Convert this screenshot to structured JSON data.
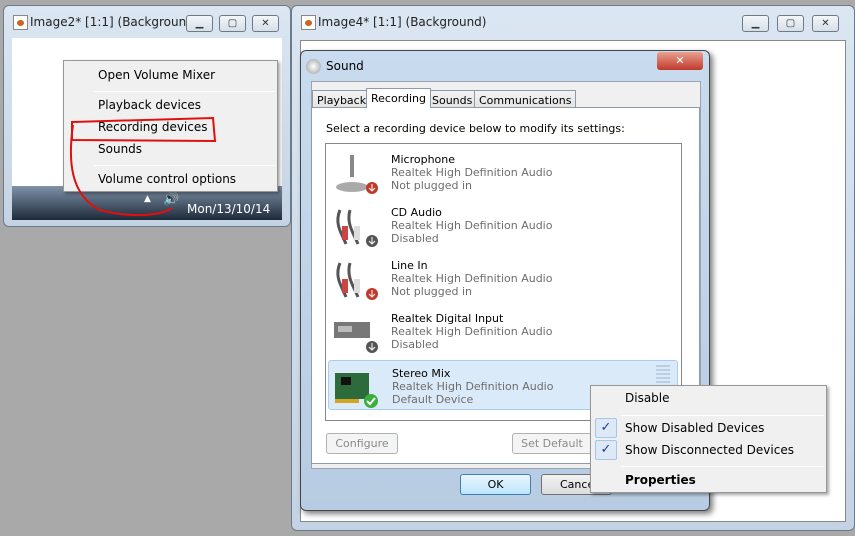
{
  "window1": {
    "title": "Image2* [1:1] (Background)",
    "clock": "Mon/13/10/14",
    "menu": [
      "Open Volume Mixer",
      "Playback devices",
      "Recording devices",
      "Sounds",
      "Volume control options"
    ]
  },
  "window2": {
    "title": "Image4* [1:1] (Background)"
  },
  "dialog": {
    "title": "Sound",
    "tabs": [
      "Playback",
      "Recording",
      "Sounds",
      "Communications"
    ],
    "active_tab": "Recording",
    "instruction": "Select a recording device below to modify its settings:",
    "devices": [
      {
        "name": "Microphone",
        "driver": "Realtek High Definition Audio",
        "status": "Not plugged in",
        "icon": "microphone-icon"
      },
      {
        "name": "CD Audio",
        "driver": "Realtek High Definition Audio",
        "status": "Disabled",
        "icon": "cd-audio-icon"
      },
      {
        "name": "Line In",
        "driver": "Realtek High Definition Audio",
        "status": "Not plugged in",
        "icon": "line-in-icon"
      },
      {
        "name": "Realtek Digital Input",
        "driver": "Realtek High Definition Audio",
        "status": "Disabled",
        "icon": "digital-input-icon"
      },
      {
        "name": "Stereo Mix",
        "driver": "Realtek High Definition Audio",
        "status": "Default Device",
        "icon": "sound-card-icon",
        "selected": true
      }
    ],
    "configure": "Configure",
    "set_default": "Set Default",
    "ok": "OK",
    "cancel": "Cancel"
  },
  "context_menu": {
    "items": [
      {
        "label": "Disable"
      },
      {
        "label": "Show Disabled Devices",
        "checked": true
      },
      {
        "label": "Show Disconnected Devices",
        "checked": true
      },
      {
        "label": "Properties",
        "bold": true
      }
    ]
  },
  "colors": {
    "annotation": "#e01010",
    "selection": "#cde3f8"
  }
}
